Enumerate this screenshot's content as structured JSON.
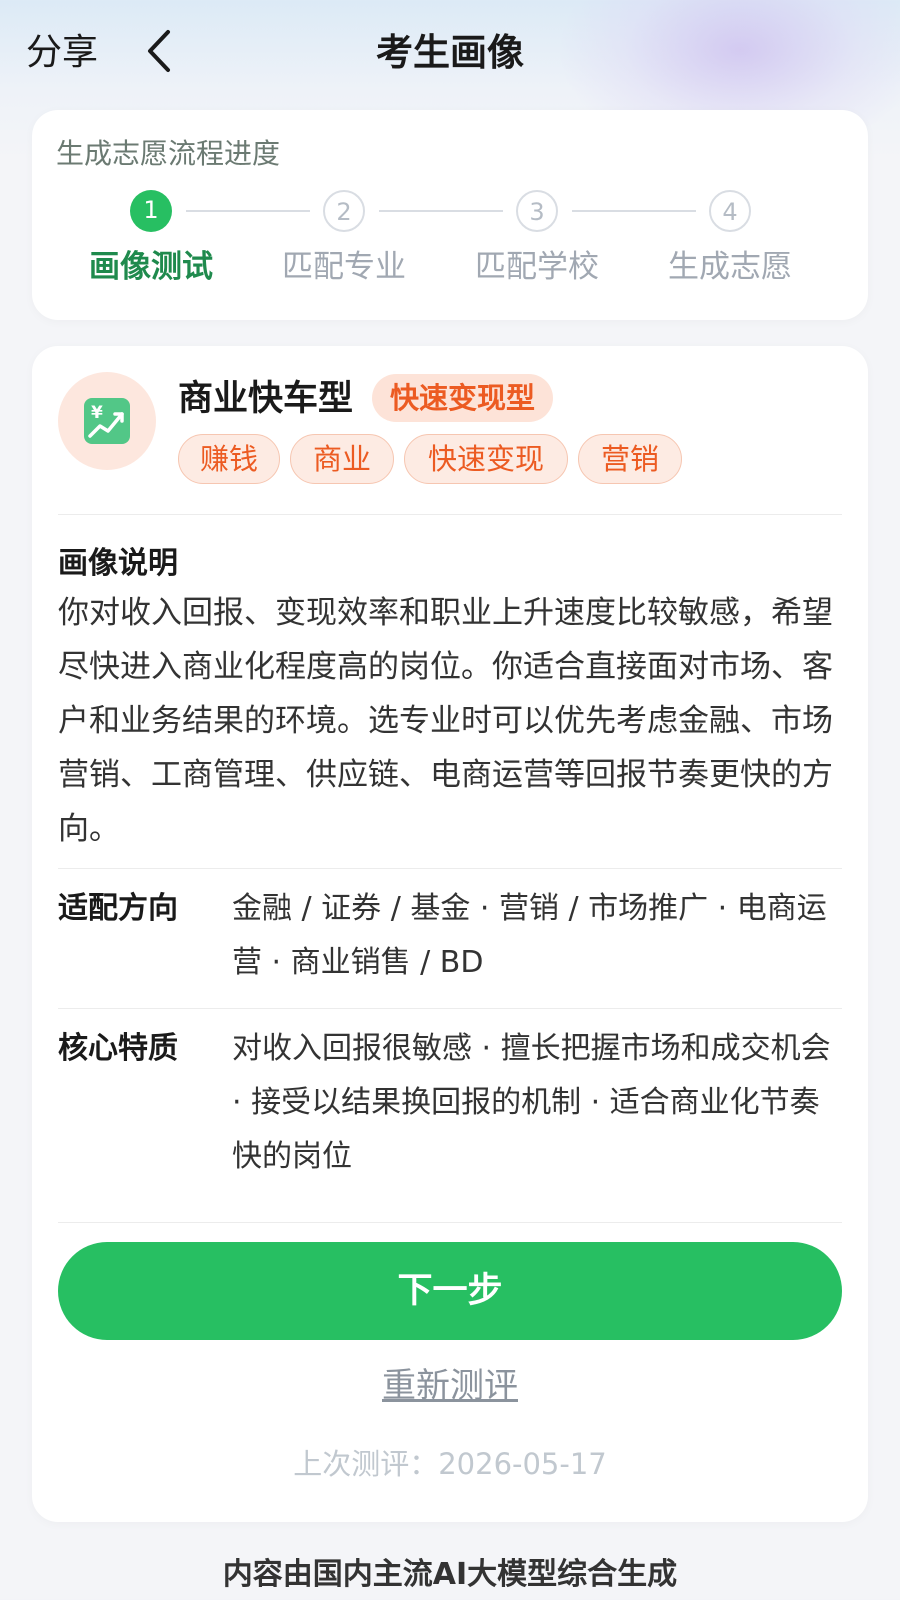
{
  "header": {
    "share_label": "分享",
    "title": "考生画像"
  },
  "progress": {
    "title": "生成志愿流程进度",
    "steps": [
      {
        "num": "1",
        "label": "画像测试",
        "active": true
      },
      {
        "num": "2",
        "label": "匹配专业",
        "active": false
      },
      {
        "num": "3",
        "label": "匹配学校",
        "active": false
      },
      {
        "num": "4",
        "label": "生成志愿",
        "active": false
      }
    ]
  },
  "profile": {
    "icon": "chart-money-icon",
    "name": "商业快车型",
    "badge": "快速变现型",
    "tags": [
      "赚钱",
      "商业",
      "快速变现",
      "营销"
    ],
    "desc_title": "画像说明",
    "description": "你对收入回报、变现效率和职业上升速度比较敏感，希望尽快进入商业化程度高的岗位。你适合直接面对市场、客户和业务结果的环境。选专业时可以优先考虑金融、市场营销、工商管理、供应链、电商运营等回报节奏更快的方向。",
    "direction_label": "适配方向",
    "direction_value": "金融 / 证券 / 基金 · 营销 / 市场推广 · 电商运营 · 商业销售 / BD",
    "trait_label": "核心特质",
    "trait_value": "对收入回报很敏感 · 擅长把握市场和成交机会 · 接受以结果换回报的机制 · 适合商业化节奏快的岗位"
  },
  "actions": {
    "next_label": "下一步",
    "retest_label": "重新测评",
    "last_test": "上次测评：2026-05-17"
  },
  "footer": "内容由国内主流AI大模型综合生成",
  "colors": {
    "accent": "#27bf62",
    "orange": "#ec5b22"
  }
}
